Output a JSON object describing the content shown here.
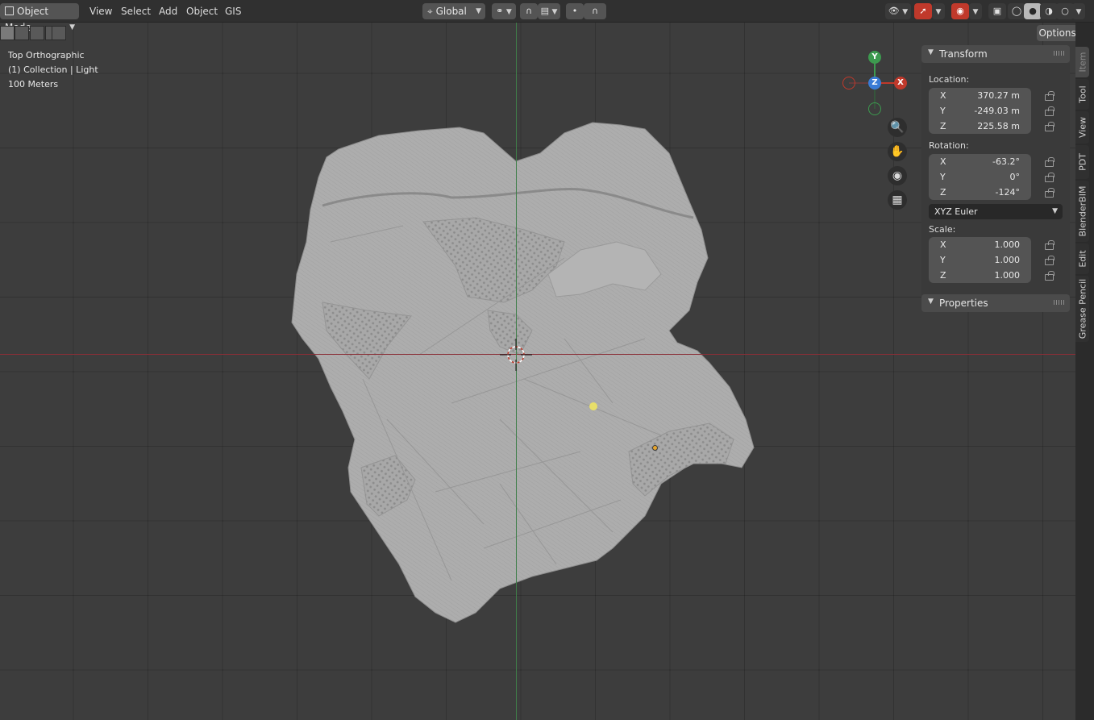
{
  "header": {
    "mode": "Object Mode",
    "menus": [
      "View",
      "Select",
      "Add",
      "Object",
      "GIS"
    ],
    "transform_orientation": "Global",
    "icons": [
      "pivot-icon",
      "snap-icon",
      "snap-target-icon",
      "proportional-edit-icon",
      "falloff-icon",
      "visibility-icon",
      "gizmo-icon",
      "overlay-icon",
      "xray-icon",
      "wireframe-shading-icon",
      "solid-shading-icon",
      "material-shading-icon",
      "rendered-shading-icon"
    ]
  },
  "viewport": {
    "view_name": "Top Orthographic",
    "collection": "(1) Collection | Light",
    "scale": "100 Meters",
    "options_label": "Options",
    "gizmo": {
      "y": "Y",
      "z": "Z",
      "x": "X"
    },
    "colors": {
      "x_axis": "#8a2f37",
      "y_axis": "#3f7e49",
      "gizmo_x": "#c0392b",
      "gizmo_y": "#3d9a4f",
      "gizmo_z": "#3a7bd5",
      "light": "#e8df6a"
    }
  },
  "npanel": {
    "transform_title": "Transform",
    "location_label": "Location:",
    "location": [
      {
        "axis": "X",
        "value": "370.27 m"
      },
      {
        "axis": "Y",
        "value": "-249.03 m"
      },
      {
        "axis": "Z",
        "value": "225.58 m"
      }
    ],
    "rotation_label": "Rotation:",
    "rotation": [
      {
        "axis": "X",
        "value": "-63.2°"
      },
      {
        "axis": "Y",
        "value": "0°"
      },
      {
        "axis": "Z",
        "value": "-124°"
      }
    ],
    "rotation_mode": "XYZ Euler",
    "scale_label": "Scale:",
    "scale": [
      {
        "axis": "X",
        "value": "1.000"
      },
      {
        "axis": "Y",
        "value": "1.000"
      },
      {
        "axis": "Z",
        "value": "1.000"
      }
    ],
    "properties_title": "Properties"
  },
  "tabs": [
    "Item",
    "Tool",
    "View",
    "PDT",
    "BlenderBIM",
    "Edit",
    "Grease Pencil"
  ]
}
